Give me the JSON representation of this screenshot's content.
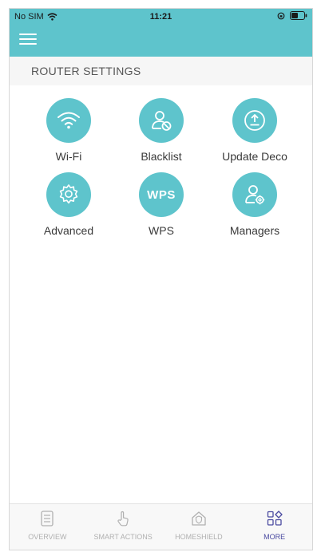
{
  "status_bar": {
    "carrier": "No SIM",
    "time": "11:21"
  },
  "section": {
    "title": "ROUTER SETTINGS"
  },
  "settings": [
    {
      "label": "Wi-Fi",
      "icon": "wifi-icon"
    },
    {
      "label": "Blacklist",
      "icon": "user-block-icon"
    },
    {
      "label": "Update Deco",
      "icon": "upload-icon"
    },
    {
      "label": "Advanced",
      "icon": "gear-icon"
    },
    {
      "label": "WPS",
      "icon": "wps-icon",
      "badge": "WPS"
    },
    {
      "label": "Managers",
      "icon": "user-gear-icon"
    }
  ],
  "tabbar": {
    "tabs": [
      {
        "label": "OVERVIEW",
        "icon": "document-icon"
      },
      {
        "label": "SMART ACTIONS",
        "icon": "hand-pointer-icon"
      },
      {
        "label": "HOMESHIELD",
        "icon": "house-shield-icon"
      },
      {
        "label": "MORE",
        "icon": "grid-icon",
        "active": true
      }
    ]
  },
  "colors": {
    "accent": "#5ec4cc",
    "active_tab": "#4a4aa0",
    "inactive_tab": "#b0b0b0"
  }
}
